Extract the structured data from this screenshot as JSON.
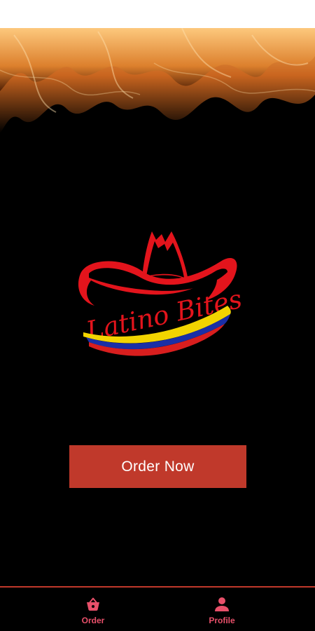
{
  "brand": {
    "name": "Latino Bites",
    "accent_color": "#c0392b",
    "nav_color": "#e8506a",
    "flag_colors": [
      "#f2d400",
      "#1a2fa6",
      "#d81e1e"
    ]
  },
  "main": {
    "order_button_label": "Order Now"
  },
  "bottom_nav": {
    "items": [
      {
        "label": "Order",
        "icon": "shopping-basket-icon",
        "active": true
      },
      {
        "label": "Profile",
        "icon": "user-icon",
        "active": false
      }
    ]
  }
}
